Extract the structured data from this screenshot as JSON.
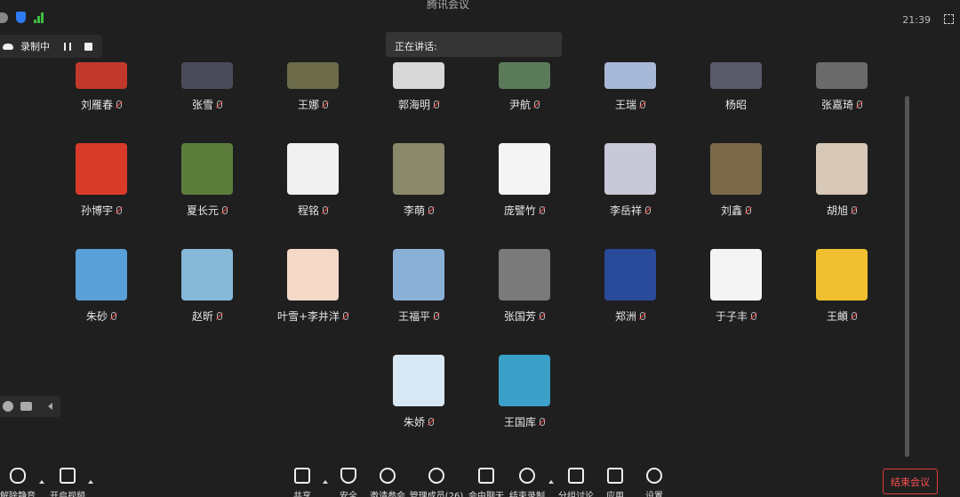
{
  "topbar": {
    "meeting_title": "腾讯会议",
    "clock": "21:39"
  },
  "recording": {
    "status": "录制中"
  },
  "speaking": {
    "label": "正在讲话:"
  },
  "participants": [
    "刘雁春",
    "张雪",
    "王娜",
    "郭海明",
    "尹航",
    "王瑞",
    "杨昭",
    "张嘉琦",
    "孙博宇",
    "夏长元",
    "程铭",
    "李萌",
    "庞譬竹",
    "李岳祥",
    "刘鑫",
    "胡旭",
    "朱砂",
    "赵昕",
    "叶雪+李井洋",
    "王福平",
    "张国芳",
    "郑洲",
    "于子丰",
    "王頔",
    "朱娇",
    "王国库"
  ],
  "toolbar": {
    "unmute": "解除静音",
    "start_video": "开启视频",
    "share": "共享",
    "security": "安全",
    "invite": "邀请参会",
    "manage": "管理成员(26)",
    "chat": "会中聊天",
    "end_record": "结束录制",
    "breakout": "分组讨论",
    "apps": "应用",
    "settings": "设置"
  },
  "end_meeting": "结束会议",
  "colors": {
    "end_red": "#e23b3b",
    "shield_blue": "#2d7cf6",
    "signal_green": "#3fbf3f"
  }
}
